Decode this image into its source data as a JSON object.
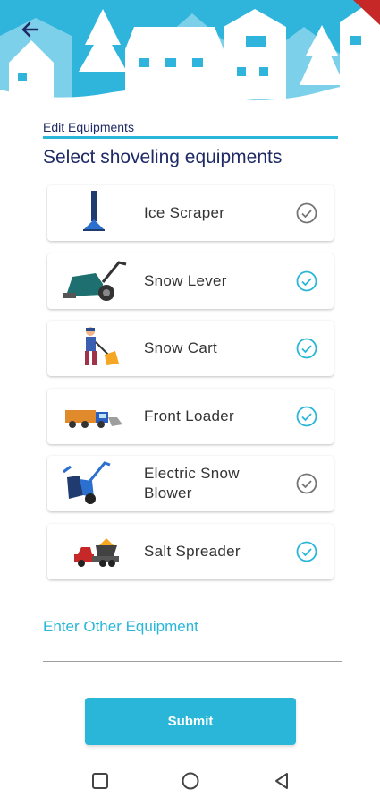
{
  "header": {
    "back_icon": "arrow-back-icon"
  },
  "section_title": "Edit Equipments",
  "heading": "Select shoveling equipments",
  "colors": {
    "accent": "#29b6d8",
    "heading": "#1f2a66",
    "checked": "#29b6d8",
    "unchecked": "#757575"
  },
  "equipments": [
    {
      "label": "Ice Scraper",
      "checked": false
    },
    {
      "label": "Snow Lever",
      "checked": true
    },
    {
      "label": "Snow Cart",
      "checked": true
    },
    {
      "label": "Front Loader",
      "checked": true
    },
    {
      "label": "Electric Snow Blower",
      "checked": false
    },
    {
      "label": "Salt Spreader",
      "checked": true
    }
  ],
  "other_equipment": {
    "placeholder": "Enter Other Equipment",
    "value": ""
  },
  "submit_label": "Submit",
  "navbar": {
    "recents_icon": "square-icon",
    "home_icon": "circle-icon",
    "back_icon": "triangle-back-icon"
  }
}
